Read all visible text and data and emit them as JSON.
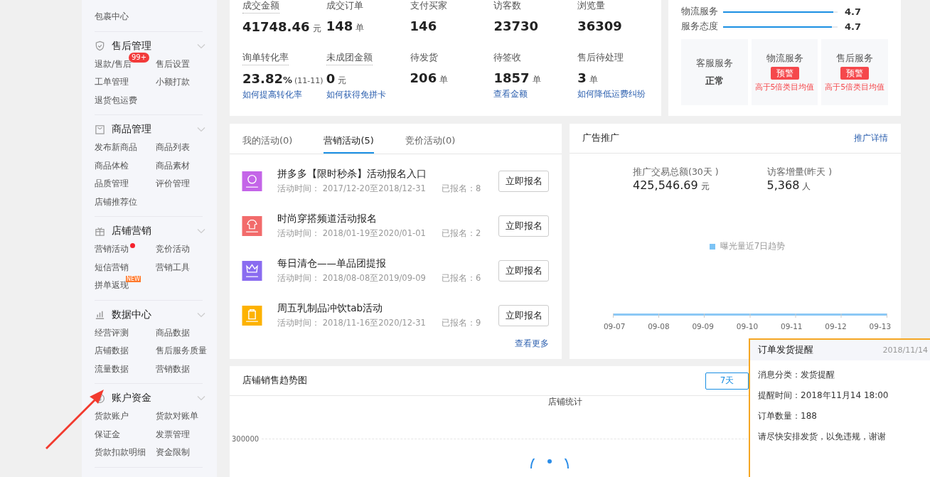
{
  "sidebar": {
    "sections": [
      {
        "items": [
          {
            "label": "包裹中心"
          }
        ]
      },
      {
        "title": "售后管理",
        "items": [
          {
            "label": "退款/售后",
            "badge": "99+"
          },
          {
            "label": "售后设置"
          },
          {
            "label": "工单管理"
          },
          {
            "label": "小额打款"
          },
          {
            "label": "退货包运费"
          }
        ]
      },
      {
        "title": "商品管理",
        "items": [
          {
            "label": "发布新商品"
          },
          {
            "label": "商品列表"
          },
          {
            "label": "商品体检"
          },
          {
            "label": "商品素材"
          },
          {
            "label": "品质管理"
          },
          {
            "label": "评价管理"
          },
          {
            "label": "店铺推荐位"
          }
        ]
      },
      {
        "title": "店铺营销",
        "items": [
          {
            "label": "营销活动",
            "dot": true
          },
          {
            "label": "竞价活动"
          },
          {
            "label": "短信营销"
          },
          {
            "label": "营销工具"
          },
          {
            "label": "拼单返现",
            "tag": "NEW"
          }
        ]
      },
      {
        "title": "数据中心",
        "items": [
          {
            "label": "经营评测"
          },
          {
            "label": "商品数据"
          },
          {
            "label": "店铺数据"
          },
          {
            "label": "售后服务质量"
          },
          {
            "label": "流量数据"
          },
          {
            "label": "营销数据"
          }
        ]
      },
      {
        "title": "账户资金",
        "items": [
          {
            "label": "货款账户"
          },
          {
            "label": "货款对账单"
          },
          {
            "label": "保证金"
          },
          {
            "label": "发票管理"
          },
          {
            "label": "货款扣款明细"
          },
          {
            "label": "资金限制"
          }
        ]
      }
    ]
  },
  "stats": [
    {
      "label": "成交金额",
      "underlined": true,
      "value": "41748.46",
      "unit": "元"
    },
    {
      "label": "成交订单",
      "underlined": false,
      "value": "148",
      "unit": "单"
    },
    {
      "label": "支付买家",
      "underlined": false,
      "value": "146"
    },
    {
      "label": "访客数",
      "underlined": false,
      "value": "23730"
    },
    {
      "label": "浏览量",
      "underlined": false,
      "value": "36309"
    },
    {
      "label": "询单转化率",
      "underlined": true,
      "value": "23.82",
      "unit": "%",
      "note": "(11-11)",
      "link": "如何提高转化率"
    },
    {
      "label": "未成团金额",
      "underlined": true,
      "value": "0",
      "unit": "元",
      "link": "如何获得免拼卡"
    },
    {
      "label": "待发货",
      "underlined": false,
      "value": "206",
      "unit": "单"
    },
    {
      "label": "待签收",
      "underlined": false,
      "value": "1857",
      "unit": "单",
      "link": "查看金额"
    },
    {
      "label": "售后待处理",
      "underlined": false,
      "value": "3",
      "unit": "单",
      "link": "如何降低运费纠纷"
    }
  ],
  "ratings": [
    {
      "label": "物流服务",
      "level": 0.96,
      "value": "4.7"
    },
    {
      "label": "服务态度",
      "level": 0.95,
      "value": "4.7"
    }
  ],
  "services": [
    {
      "kind": "normal",
      "title": "客服服务",
      "status": "正常"
    },
    {
      "kind": "warning",
      "title": "物流服务",
      "status": "预警",
      "note": "高于5倍类目均值"
    },
    {
      "kind": "warning",
      "title": "售后服务",
      "status": "预警",
      "note": "高于5倍类目均值"
    }
  ],
  "activity_tabs": [
    {
      "label": "我的活动(0)",
      "selected": false
    },
    {
      "label": "营销活动(5)",
      "selected": true
    },
    {
      "label": "竞价活动(0)",
      "selected": false
    }
  ],
  "activities": [
    {
      "title": "拼多多【限时秒杀】活动报名入口",
      "time": "活动时间： 2017/12-20至2018/12-31",
      "signed": "已报名：8",
      "color": "#c465e8",
      "button": "立即报名"
    },
    {
      "title": "时尚穿搭频道活动报名",
      "time": "活动时间： 2018/01-19至2020/01-01",
      "signed": "已报名：2",
      "color": "#f26b6b",
      "button": "立即报名"
    },
    {
      "title": "每日清仓——单品团提报",
      "time": "活动时间： 2018/08-08至2019/09-09",
      "signed": "已报名：6",
      "color": "#8a6cf0",
      "button": "立即报名"
    },
    {
      "title": "周五乳制品冲饮tab活动",
      "time": "活动时间： 2018/11-16至2020/12-31",
      "signed": "已报名：9",
      "color": "#fdb200",
      "button": "立即报名"
    }
  ],
  "more_link": "查看更多",
  "ad": {
    "title": "广告推广",
    "link": "推广详情",
    "metrics": [
      {
        "label": "推广交易总额(30天 )",
        "value": "425,546.69",
        "unit": "元"
      },
      {
        "label": "访客增量(昨天 )",
        "value": "5,368",
        "unit": "人"
      }
    ],
    "legend": "曝光量近7日趋势",
    "x_labels": [
      "09-07",
      "09-08",
      "09-09",
      "09-10",
      "09-11",
      "09-12",
      "09-13"
    ]
  },
  "sales": {
    "title": "店铺销售趋势图",
    "range_button": "7天",
    "chart_title": "店铺统计",
    "y_tick": "300000"
  },
  "notification": {
    "title": "订单发货提醒",
    "date": "2018/11/14",
    "lines": [
      "消息分类：发货提醒",
      "提醒时间：2018年11月14  18:00",
      "订单数量：188",
      "请尽快安排发货，以免违规，谢谢"
    ]
  }
}
